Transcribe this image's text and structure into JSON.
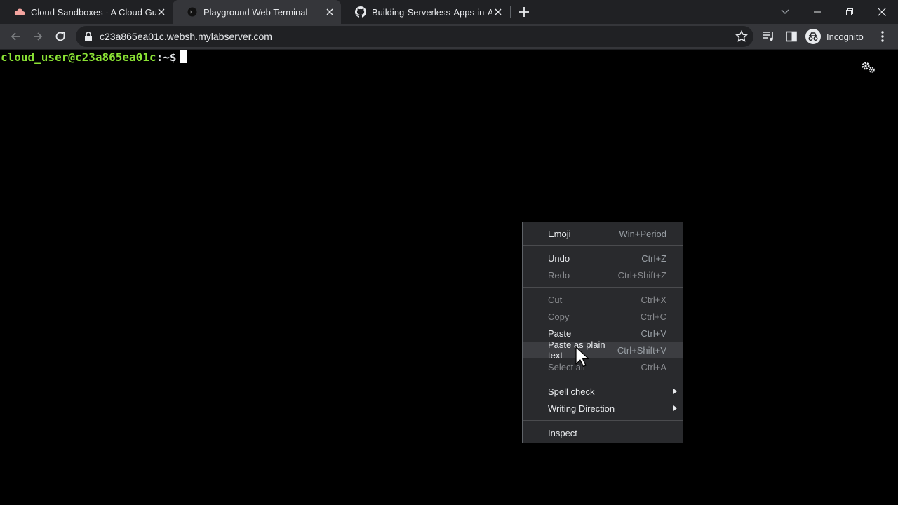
{
  "tabs": [
    {
      "title": "Cloud Sandboxes - A Cloud Guru",
      "favicon": "cloud-icon",
      "active": false
    },
    {
      "title": "Playground Web Terminal",
      "favicon": "terminal-icon",
      "active": true
    },
    {
      "title": "Building-Serverless-Apps-in-AWS",
      "favicon": "github-icon",
      "active": false
    }
  ],
  "address_bar": {
    "url": "c23a865ea01c.websh.mylabserver.com"
  },
  "profile": {
    "label": "Incognito"
  },
  "terminal": {
    "prompt_user": "cloud_user@c23a865ea01c",
    "prompt_path": ":~$"
  },
  "context_menu": {
    "items": [
      {
        "label": "Emoji",
        "shortcut": "Win+Period",
        "enabled": true
      },
      {
        "label": "Undo",
        "shortcut": "Ctrl+Z",
        "enabled": true
      },
      {
        "label": "Redo",
        "shortcut": "Ctrl+Shift+Z",
        "enabled": false
      },
      {
        "label": "Cut",
        "shortcut": "Ctrl+X",
        "enabled": false
      },
      {
        "label": "Copy",
        "shortcut": "Ctrl+C",
        "enabled": false
      },
      {
        "label": "Paste",
        "shortcut": "Ctrl+V",
        "enabled": true
      },
      {
        "label": "Paste as plain text",
        "shortcut": "Ctrl+Shift+V",
        "enabled": true,
        "hovered": true
      },
      {
        "label": "Select all",
        "shortcut": "Ctrl+A",
        "enabled": false
      },
      {
        "label": "Spell check",
        "shortcut": "",
        "enabled": true,
        "submenu": true
      },
      {
        "label": "Writing Direction",
        "shortcut": "",
        "enabled": true,
        "submenu": true
      },
      {
        "label": "Inspect",
        "shortcut": "",
        "enabled": true
      }
    ]
  },
  "colors": {
    "prompt_green": "#8ae234",
    "tabstrip_bg": "#202124",
    "toolbar_bg": "#35363a",
    "menu_bg": "#292a2d"
  }
}
